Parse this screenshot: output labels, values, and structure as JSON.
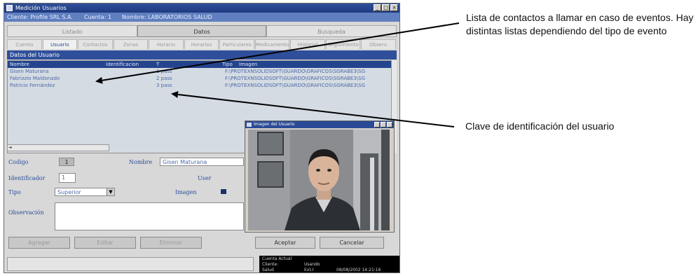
{
  "window": {
    "title": "Medición Usuarios",
    "info": {
      "client": "Cliente: Profile SRL S.A.",
      "cuenta": "Cuenta: 1",
      "nombre": "Nombre: LABORATORIOS SALUD"
    }
  },
  "tabs_top": [
    "Listado",
    "Datos",
    "Busqueda"
  ],
  "tabs_sub": [
    "Cuenta",
    "Usuario",
    "Contactos",
    "Zonas",
    "Horario",
    "Horarios",
    "Particulares",
    "Medicamentos",
    "Historial",
    "Seguimiento",
    "Observ."
  ],
  "section_title": "Datos del Usuario",
  "grid": {
    "headers": [
      "Nombre",
      "Identificacion",
      "T",
      "Tipo",
      "Imagen"
    ],
    "rows": [
      [
        "Gisen Maturana",
        "1 pass",
        "1",
        "1",
        "F:\\PROTEXNSOLIDSOFT\\GUARDO\\GRAFICOS\\SGRABE3\\SGR..."
      ],
      [
        "Fabrizzio Maldonado",
        "2 pass",
        "2",
        "2",
        "F:\\PROTEXNSOLIDSOFT\\GUARDO\\GRAFICOS\\SGRABE3\\SGR..."
      ],
      [
        "Patricio Fernández",
        "3 pass",
        "3",
        "2",
        "F:\\PROTEXNSOLIDSOFT\\GUARDO\\GRAFICOS\\SGRABE3\\SGR..."
      ]
    ]
  },
  "form": {
    "codigo_label": "Codigo",
    "codigo_value": "1",
    "nombre_label": "Nombre",
    "nombre_value": "Gisen Maturana",
    "identificador_label": "Identificador",
    "identificador_value": "1",
    "user_label": "User",
    "tipo_label": "Tipo",
    "tipo_value": "Superior",
    "imagen_label": "Imagen",
    "observacion_label": "Observación"
  },
  "buttons": {
    "agregar": "Agregar",
    "editar": "Editar",
    "eliminar": "Eliminar",
    "aceptar": "Aceptar",
    "cancelar": "Cancelar"
  },
  "status": {
    "line1": "Cuenta Actual",
    "line2a": "Cliente:",
    "line2b": "Usando",
    "line3a": "Salud",
    "line3b": "Ext.I",
    "line3c": "08/08/2002 14:21:16"
  },
  "popup": {
    "title": "Imagen del Usuario"
  },
  "annotations": {
    "contacts_text": "Lista de contactos a llamar en caso de eventos.  Hay distintas listas dependiendo del tipo de evento",
    "user_key_text": "Clave de identificación del usuario"
  },
  "colors": {
    "titlebar": "#2f4f9a",
    "grid_bg": "#d4dbe2",
    "status_bg": "#000000"
  }
}
